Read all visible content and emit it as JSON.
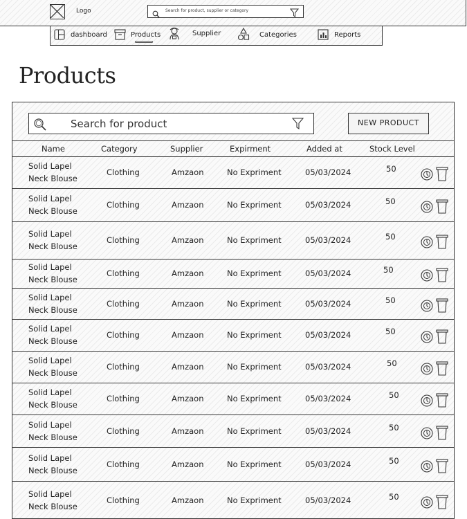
{
  "topbar": {
    "logo_label": "Logo",
    "search_placeholder": "Search for product, supplier or category"
  },
  "nav": {
    "items": [
      {
        "label": "dashboard",
        "icon": "dashboard-icon"
      },
      {
        "label": "Products",
        "icon": "box-icon",
        "active": true
      },
      {
        "label": "Supplier",
        "icon": "supplier-icon"
      },
      {
        "label": "Categories",
        "icon": "shapes-icon"
      },
      {
        "label": "Reports",
        "icon": "bar-chart-icon"
      }
    ]
  },
  "page": {
    "title": "Products"
  },
  "panel": {
    "search_placeholder": "Search for product",
    "new_button_label": "NEW PRODUCT"
  },
  "table": {
    "columns": [
      "Name",
      "Category",
      "Supplier",
      "Expirment",
      "Added at",
      "Stock Level"
    ],
    "rows": [
      {
        "name_line1": "Solid Lapel",
        "name_line2": "Neck Blouse",
        "category": "Clothing",
        "supplier": "Amzaon",
        "expiry": "No Expriment",
        "added": "05/03/2024",
        "stock": "50"
      },
      {
        "name_line1": "Solid Lapel",
        "name_line2": "Neck Blouse",
        "category": "Clothing",
        "supplier": "Amzaon",
        "expiry": "No Expriment",
        "added": "05/03/2024",
        "stock": "50"
      },
      {
        "name_line1": "Solid Lapel",
        "name_line2": "Neck Blouse",
        "category": "Clothing",
        "supplier": "Amzaon",
        "expiry": "No Expriment",
        "added": "05/03/2024",
        "stock": "50"
      },
      {
        "name_line1": "Solid Lapel",
        "name_line2": "Neck Blouse",
        "category": "Clothing",
        "supplier": "Amzaon",
        "expiry": "No Expriment",
        "added": "05/03/2024",
        "stock": "50"
      },
      {
        "name_line1": "Solid Lapel",
        "name_line2": "Neck Blouse",
        "category": "Clothing",
        "supplier": "Amzaon",
        "expiry": "No Expriment",
        "added": "05/03/2024",
        "stock": "50"
      },
      {
        "name_line1": "Solid Lapel",
        "name_line2": "Neck Blouse",
        "category": "Clothing",
        "supplier": "Amzaon",
        "expiry": "No Expriment",
        "added": "05/03/2024",
        "stock": "50"
      },
      {
        "name_line1": "Solid Lapel",
        "name_line2": "Neck Blouse",
        "category": "Clothing",
        "supplier": "Amzaon",
        "expiry": "No Expriment",
        "added": "05/03/2024",
        "stock": "50"
      },
      {
        "name_line1": "Solid Lapel",
        "name_line2": "Neck Blouse",
        "category": "Clothing",
        "supplier": "Amzaon",
        "expiry": "No Expriment",
        "added": "05/03/2024",
        "stock": "50"
      },
      {
        "name_line1": "Solid Lapel",
        "name_line2": "Neck Blouse",
        "category": "Clothing",
        "supplier": "Amzaon",
        "expiry": "No Expriment",
        "added": "05/03/2024",
        "stock": "50"
      },
      {
        "name_line1": "Solid Lapel",
        "name_line2": "Neck Blouse",
        "category": "Clothing",
        "supplier": "Amzaon",
        "expiry": "No Expriment",
        "added": "05/03/2024",
        "stock": "50"
      },
      {
        "name_line1": "Solid Lapel",
        "name_line2": "Neck Blouse",
        "category": "Clothing",
        "supplier": "Amzaon",
        "expiry": "No Expriment",
        "added": "05/03/2024",
        "stock": "50"
      }
    ],
    "row_actions": [
      "edit-icon",
      "trash-icon"
    ]
  }
}
